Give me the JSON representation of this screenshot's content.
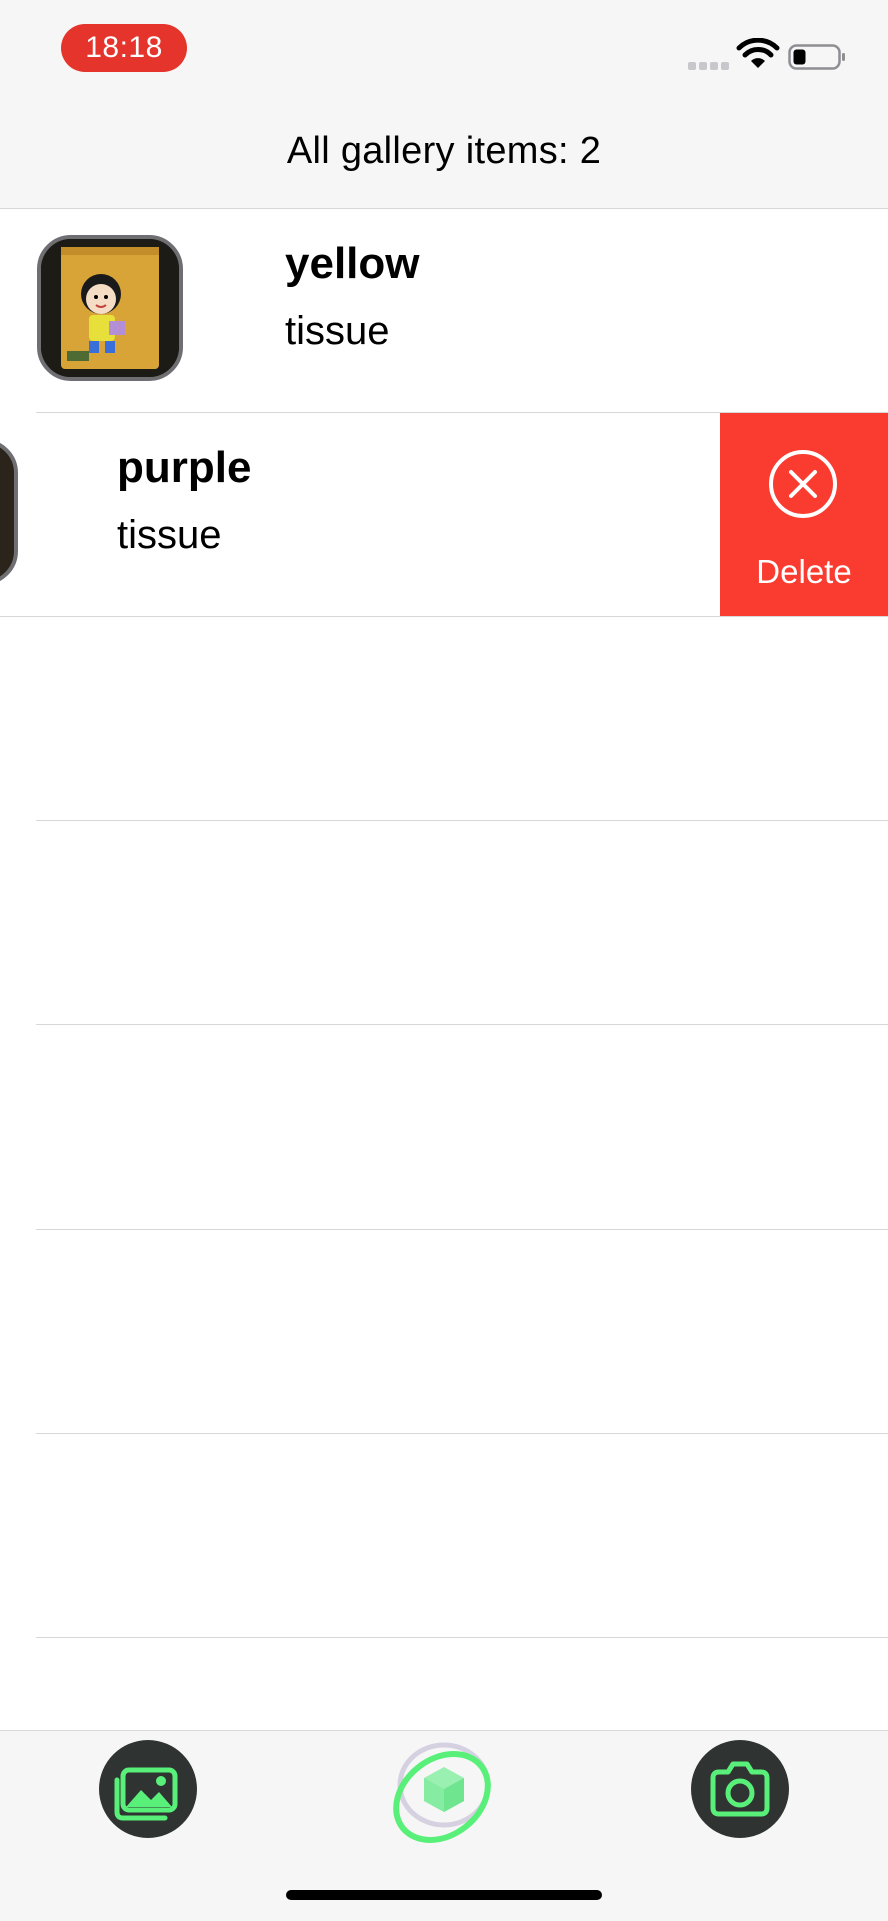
{
  "status_bar": {
    "time": "18:18",
    "time_pill_color": "#e5342b",
    "signal_icon": "signal-bars-icon",
    "wifi_icon": "wifi-icon",
    "battery_icon": "battery-icon",
    "battery_level": 0.25
  },
  "nav": {
    "title": "All gallery items: 2"
  },
  "gallery": {
    "items": [
      {
        "title": "yellow",
        "subtitle": "tissue",
        "thumbnail": "tissue-package-thumbnail"
      },
      {
        "title": "purple",
        "subtitle": "tissue",
        "thumbnail": "tissue-package-thumbnail"
      }
    ],
    "swipe_action": {
      "label": "Delete",
      "icon": "x-circle-icon",
      "color": "#fa3b30"
    }
  },
  "tabbar": {
    "left_icon": "gallery-photos-icon",
    "center_icon": "ar-cube-orbit-icon",
    "right_icon": "camera-icon",
    "accent_color": "#59f07a"
  }
}
